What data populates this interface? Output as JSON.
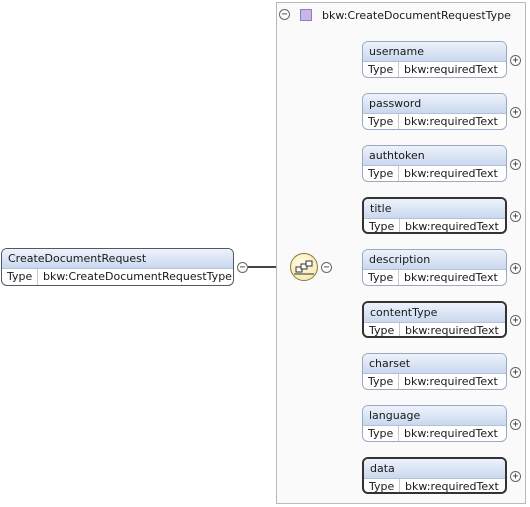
{
  "root_element": {
    "name": "CreateDocumentRequest",
    "type_label": "Type",
    "type_value": "bkw:CreateDocumentRequestType",
    "collapse_symbol": "−"
  },
  "complex_type": {
    "name": "bkw:CreateDocumentRequestType",
    "collapse_symbol": "−",
    "icon": "complex-type-icon"
  },
  "sequence": {
    "icon": "sequence-compositor-icon",
    "collapse_symbol": "−"
  },
  "elements": [
    {
      "name": "username",
      "type_label": "Type",
      "type_value": "bkw:requiredText",
      "required": false,
      "expand_symbol": "+"
    },
    {
      "name": "password",
      "type_label": "Type",
      "type_value": "bkw:requiredText",
      "required": false,
      "expand_symbol": "+"
    },
    {
      "name": "authtoken",
      "type_label": "Type",
      "type_value": "bkw:requiredText",
      "required": false,
      "expand_symbol": "+"
    },
    {
      "name": "title",
      "type_label": "Type",
      "type_value": "bkw:requiredText",
      "required": true,
      "expand_symbol": "+"
    },
    {
      "name": "description",
      "type_label": "Type",
      "type_value": "bkw:requiredText",
      "required": false,
      "expand_symbol": "+"
    },
    {
      "name": "contentType",
      "type_label": "Type",
      "type_value": "bkw:requiredText",
      "required": true,
      "expand_symbol": "+"
    },
    {
      "name": "charset",
      "type_label": "Type",
      "type_value": "bkw:requiredText",
      "required": false,
      "expand_symbol": "+"
    },
    {
      "name": "language",
      "type_label": "Type",
      "type_value": "bkw:requiredText",
      "required": false,
      "expand_symbol": "+"
    },
    {
      "name": "data",
      "type_label": "Type",
      "type_value": "bkw:requiredText",
      "required": true,
      "expand_symbol": "+"
    }
  ]
}
